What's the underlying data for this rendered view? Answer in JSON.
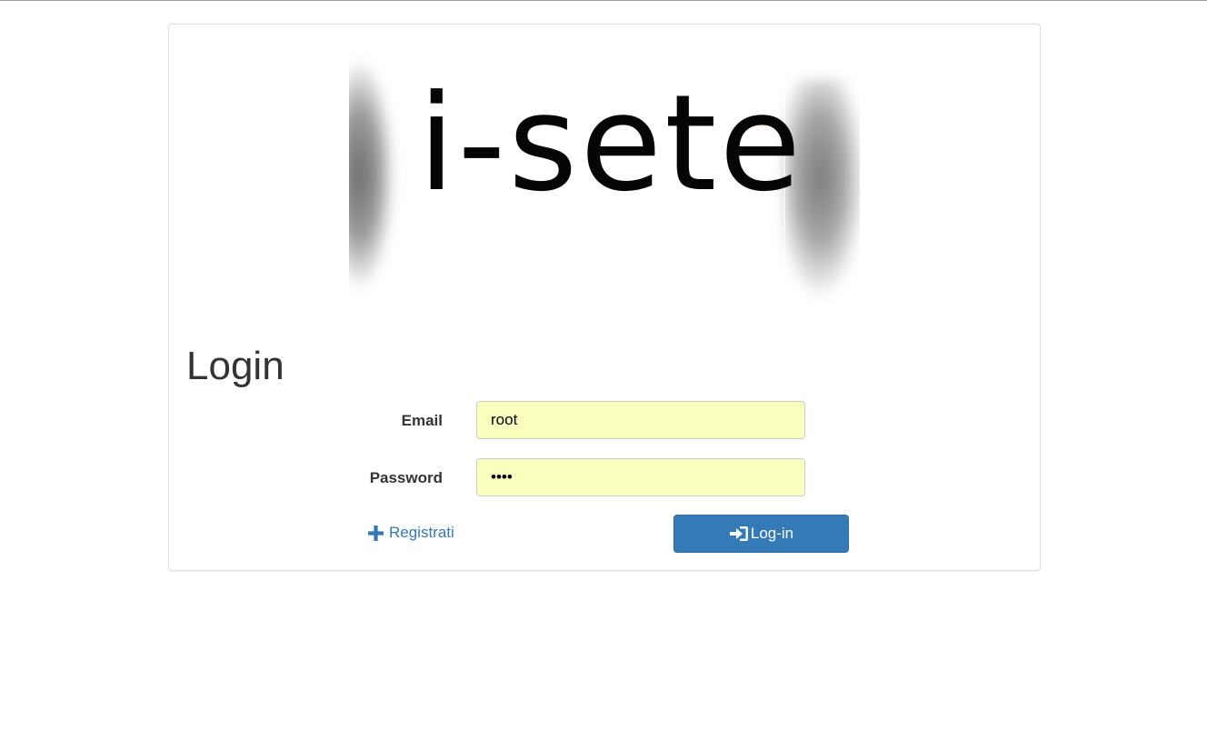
{
  "logo": {
    "text": "i-sete"
  },
  "form": {
    "title": "Login",
    "email": {
      "label": "Email",
      "value": "root"
    },
    "password": {
      "label": "Password",
      "value": "root"
    },
    "register": {
      "label": "Registrati",
      "icon": "plus-icon"
    },
    "submit": {
      "label": "Log-in",
      "icon": "log-in-icon"
    }
  },
  "colors": {
    "accent": "#337ab7",
    "autofill_background": "#faffbd",
    "panel_border": "#dddddd"
  }
}
